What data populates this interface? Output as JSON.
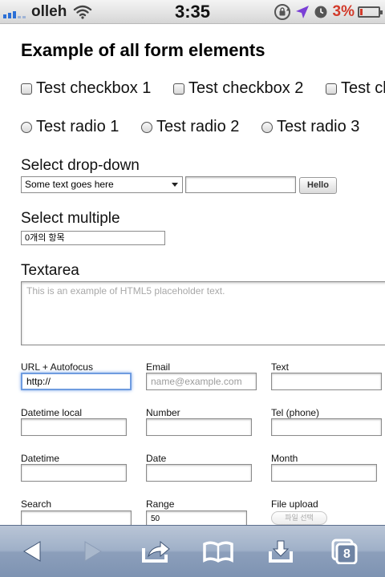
{
  "status_bar": {
    "carrier": "olleh",
    "time": "3:35",
    "battery_percent": "3%",
    "icons": [
      "signal-bars-icon",
      "wifi-icon",
      "rotation-lock-icon",
      "location-arrow-icon",
      "alarm-clock-icon",
      "battery-icon"
    ],
    "colors": {
      "signal": "#2b6fd6",
      "battery_low": "#d23a2a"
    }
  },
  "page": {
    "title": "Example of all form elements",
    "checkboxes": [
      "Test checkbox 1",
      "Test checkbox 2",
      "Test cl"
    ],
    "radios": [
      "Test radio 1",
      "Test radio 2",
      "Test radio 3"
    ],
    "select_dropdown": {
      "label": "Select drop-down",
      "selected": "Some text goes here",
      "button": "Hello"
    },
    "select_multiple": {
      "label": "Select multiple",
      "value": "0개의 항목"
    },
    "textarea": {
      "label": "Textarea",
      "placeholder": "This is an example of HTML5 placeholder text."
    },
    "fields": {
      "url": {
        "label": "URL + Autofocus",
        "value": "http://"
      },
      "email": {
        "label": "Email",
        "placeholder": "name@example.com"
      },
      "text": {
        "label": "Text",
        "value": ""
      },
      "datetime_local": {
        "label": "Datetime local",
        "value": ""
      },
      "number": {
        "label": "Number",
        "value": ""
      },
      "tel": {
        "label": "Tel (phone)",
        "value": ""
      },
      "datetime": {
        "label": "Datetime",
        "value": ""
      },
      "date": {
        "label": "Date",
        "value": ""
      },
      "month": {
        "label": "Month",
        "value": ""
      },
      "search": {
        "label": "Search",
        "value": ""
      },
      "range": {
        "label": "Range",
        "value": "50"
      },
      "file": {
        "label": "File upload",
        "button": "파일 선택"
      }
    }
  },
  "toolbar": {
    "icons": [
      "back-arrow-icon",
      "forward-arrow-icon",
      "share-icon",
      "bookmarks-book-icon",
      "download-icon",
      "tabs-icon"
    ],
    "tab_count": "8",
    "colors": {
      "bar": "#8c9fbb"
    }
  }
}
